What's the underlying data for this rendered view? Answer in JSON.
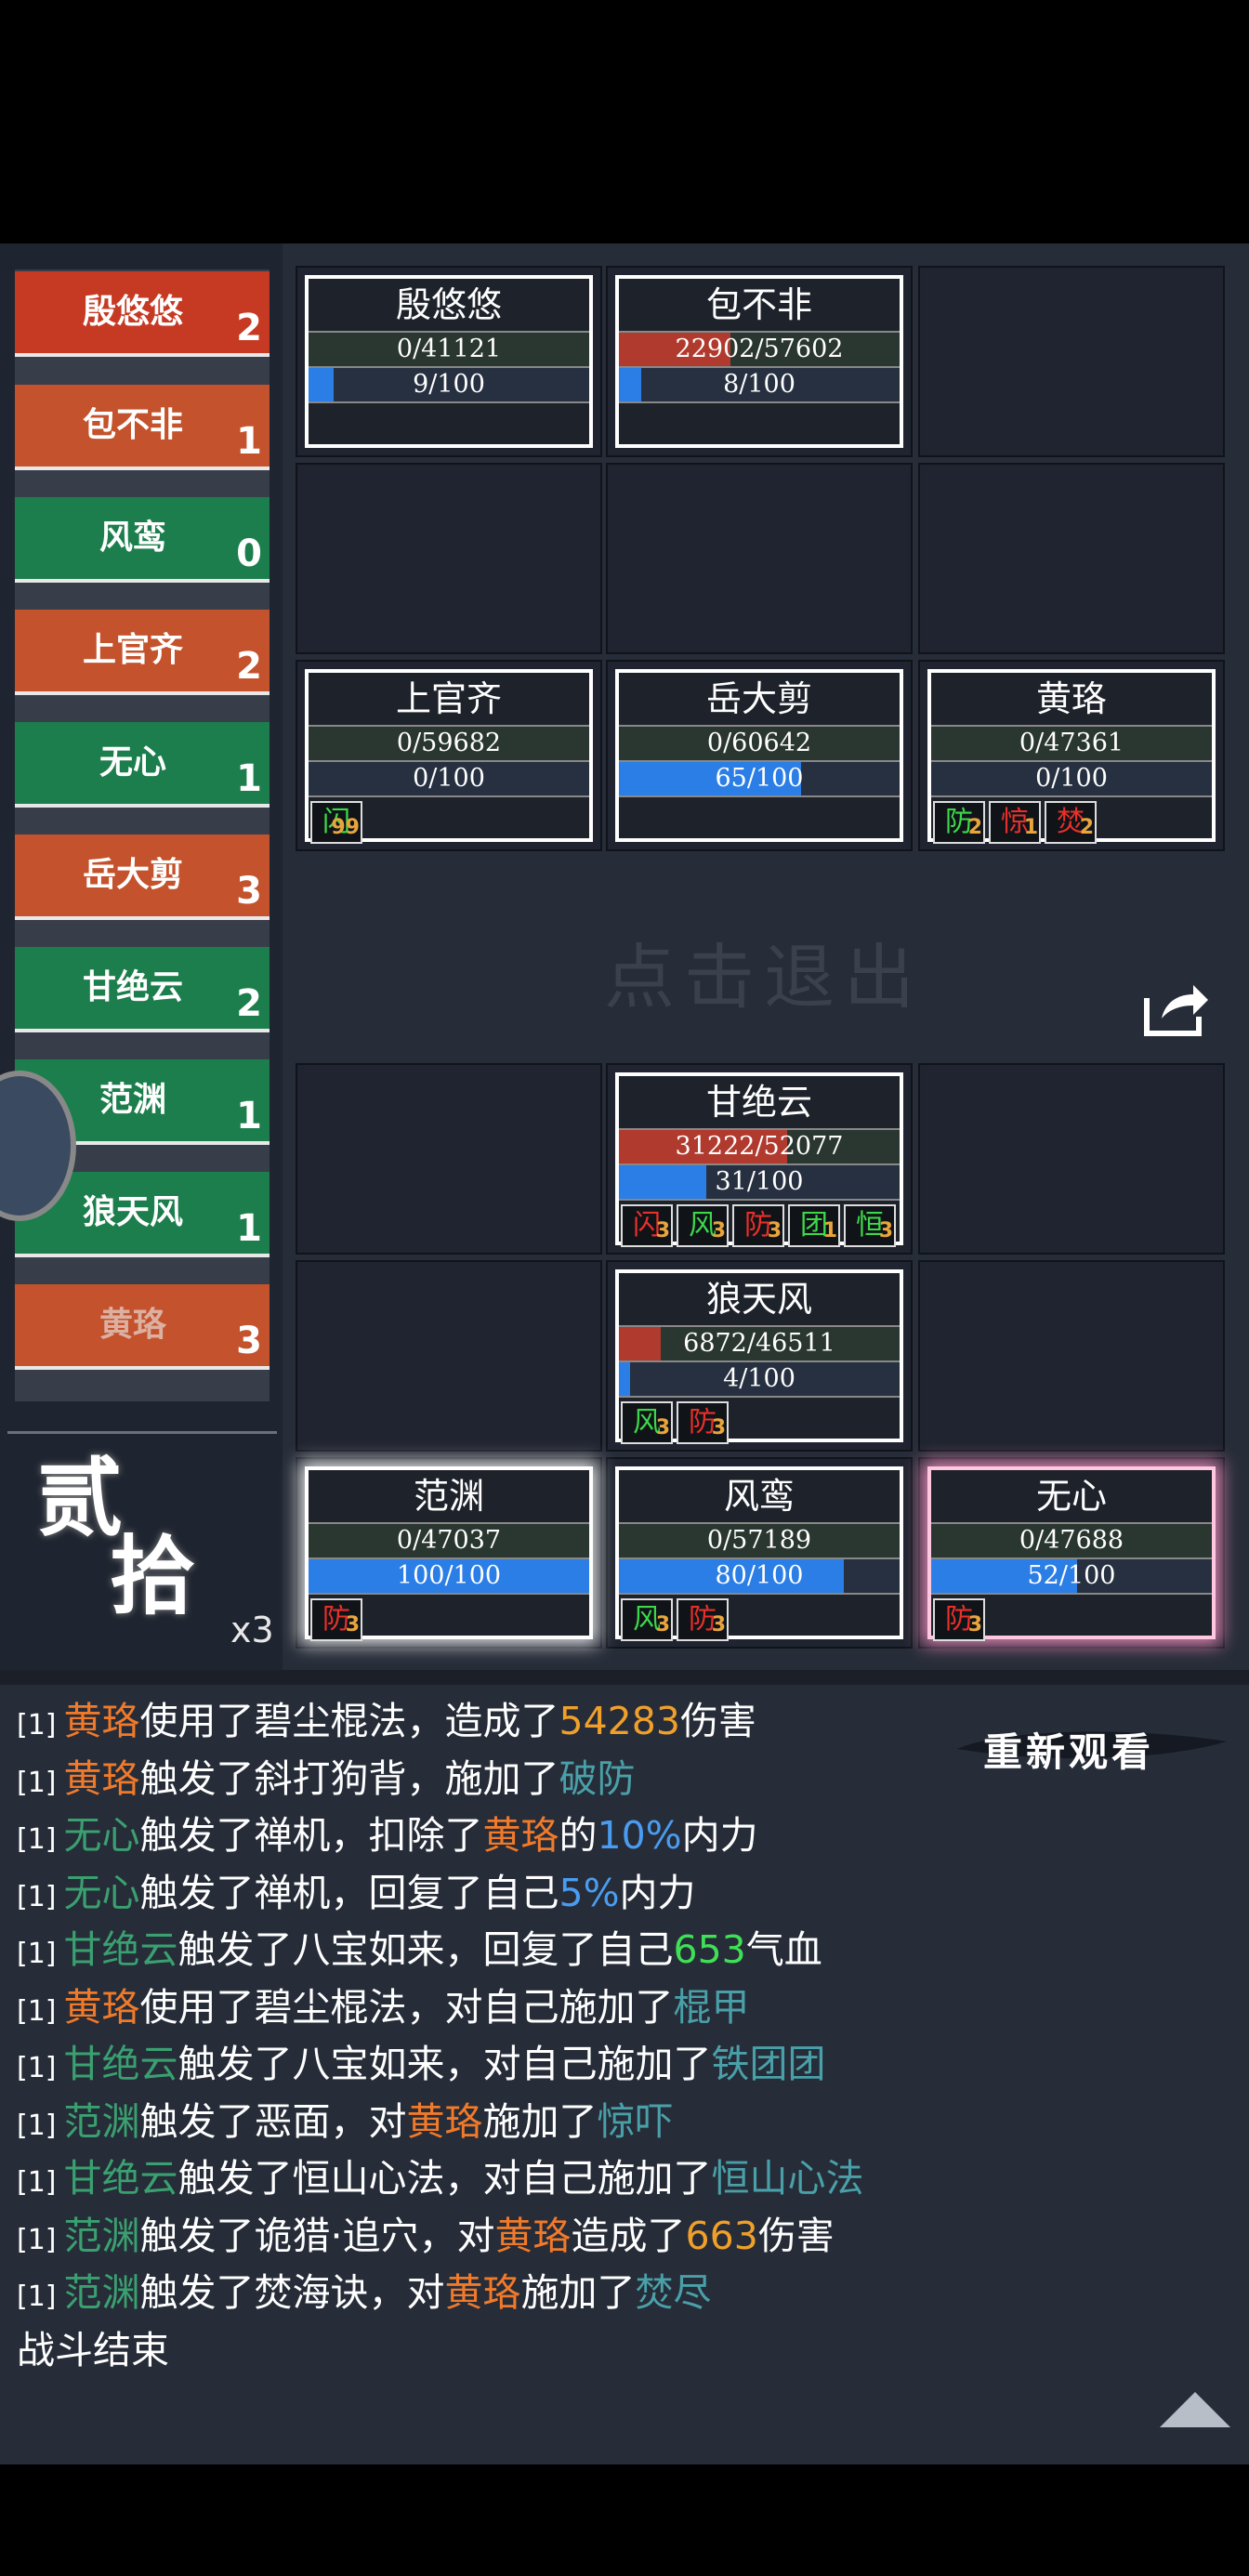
{
  "roster": [
    {
      "name": "殷悠悠",
      "count": "2"
    },
    {
      "name": "包不非",
      "count": "1"
    },
    {
      "name": "风鸾",
      "count": "0"
    },
    {
      "name": "上官齐",
      "count": "2"
    },
    {
      "name": "无心",
      "count": "1"
    },
    {
      "name": "岳大剪",
      "count": "3"
    },
    {
      "name": "甘绝云",
      "count": "2"
    },
    {
      "name": "范渊",
      "count": "1"
    },
    {
      "name": "狼天风",
      "count": "1"
    },
    {
      "name": "黄珞",
      "count": "3"
    }
  ],
  "round": {
    "line1": "贰",
    "line2": "拾",
    "multiplier": "x3"
  },
  "cards": {
    "yinyouyou": {
      "name": "殷悠悠",
      "hp": "0/41121",
      "hp_pct": 0,
      "mp": "9/100",
      "mp_pct": 9
    },
    "baobufei": {
      "name": "包不非",
      "hp": "22902/57602",
      "hp_pct": 39.8,
      "mp": "8/100",
      "mp_pct": 8
    },
    "shangguanqi": {
      "name": "上官齐",
      "hp": "0/59682",
      "hp_pct": 0,
      "mp": "0/100",
      "mp_pct": 0,
      "buffs": [
        {
          "label": "闪",
          "n": "99"
        }
      ]
    },
    "yuedajian": {
      "name": "岳大剪",
      "hp": "0/60642",
      "hp_pct": 0,
      "mp": "65/100",
      "mp_pct": 65
    },
    "huangluo": {
      "name": "黄珞",
      "hp": "0/47361",
      "hp_pct": 0,
      "mp": "0/100",
      "mp_pct": 0,
      "buffs": [
        {
          "label": "防",
          "n": "2"
        },
        {
          "label": "惊",
          "n": "1"
        },
        {
          "label": "焚",
          "n": "2"
        }
      ]
    },
    "ganjueyun": {
      "name": "甘绝云",
      "hp": "31222/52077",
      "hp_pct": 60,
      "mp": "31/100",
      "mp_pct": 31,
      "buffs": [
        {
          "label": "闪",
          "n": "3"
        },
        {
          "label": "风",
          "n": "3"
        },
        {
          "label": "防",
          "n": "3"
        },
        {
          "label": "团",
          "n": "1"
        },
        {
          "label": "恒",
          "n": "3"
        }
      ]
    },
    "langtianfeng": {
      "name": "狼天风",
      "hp": "6872/46511",
      "hp_pct": 14.8,
      "mp": "4/100",
      "mp_pct": 4,
      "buffs": [
        {
          "label": "风",
          "n": "3"
        },
        {
          "label": "防",
          "n": "3"
        }
      ]
    },
    "fanyuan": {
      "name": "范渊",
      "hp": "0/47037",
      "hp_pct": 0,
      "mp": "100/100",
      "mp_pct": 100,
      "buffs": [
        {
          "label": "防",
          "n": "3"
        }
      ]
    },
    "fengluan": {
      "name": "风鸾",
      "hp": "0/57189",
      "hp_pct": 0,
      "mp": "80/100",
      "mp_pct": 80,
      "buffs": [
        {
          "label": "风",
          "n": "3"
        },
        {
          "label": "防",
          "n": "3"
        }
      ]
    },
    "wuxin": {
      "name": "无心",
      "hp": "0/47688",
      "hp_pct": 0,
      "mp": "52/100",
      "mp_pct": 52,
      "buffs": [
        {
          "label": "防",
          "n": "3"
        }
      ]
    }
  },
  "exit_text": "点击退出",
  "replay_label": "重新观看",
  "log_prefix": "[1]",
  "log": {
    "l1": {
      "a": "黄珞",
      "b": "使用了碧尘棍法，造成了",
      "c": "54283",
      "d": "伤害"
    },
    "l2": {
      "a": "黄珞",
      "b": "触发了斜打狗背，施加了",
      "c": "破防"
    },
    "l3": {
      "a": "无心",
      "b": "触发了禅机，扣除了",
      "c": "黄珞",
      "d": "的",
      "e": "10%",
      "f": "内力"
    },
    "l4": {
      "a": "无心",
      "b": "触发了禅机，回复了自己",
      "c": "5%",
      "d": "内力"
    },
    "l5": {
      "a": "甘绝云",
      "b": "触发了八宝如来，回复了自己",
      "c": "653",
      "d": "气血"
    },
    "l6": {
      "a": "黄珞",
      "b": "使用了碧尘棍法，对自己施加了",
      "c": "棍甲"
    },
    "l7": {
      "a": "甘绝云",
      "b": "触发了八宝如来，对自己施加了",
      "c": "铁团团"
    },
    "l8": {
      "a": "范渊",
      "b": "触发了恶面，对",
      "c": "黄珞",
      "d": "施加了",
      "e": "惊吓"
    },
    "l9": {
      "a": "甘绝云",
      "b": "触发了恒山心法，对自己施加了",
      "c": "恒山心法"
    },
    "l10": {
      "a": "范渊",
      "b": "触发了诡猎·追穴，对",
      "c": "黄珞",
      "d": "造成了",
      "e": "663",
      "f": "伤害"
    },
    "l11": {
      "a": "范渊",
      "b": "触发了焚海诀，对",
      "c": "黄珞",
      "d": "施加了",
      "e": "焚尽"
    },
    "l12": "战斗结束"
  }
}
